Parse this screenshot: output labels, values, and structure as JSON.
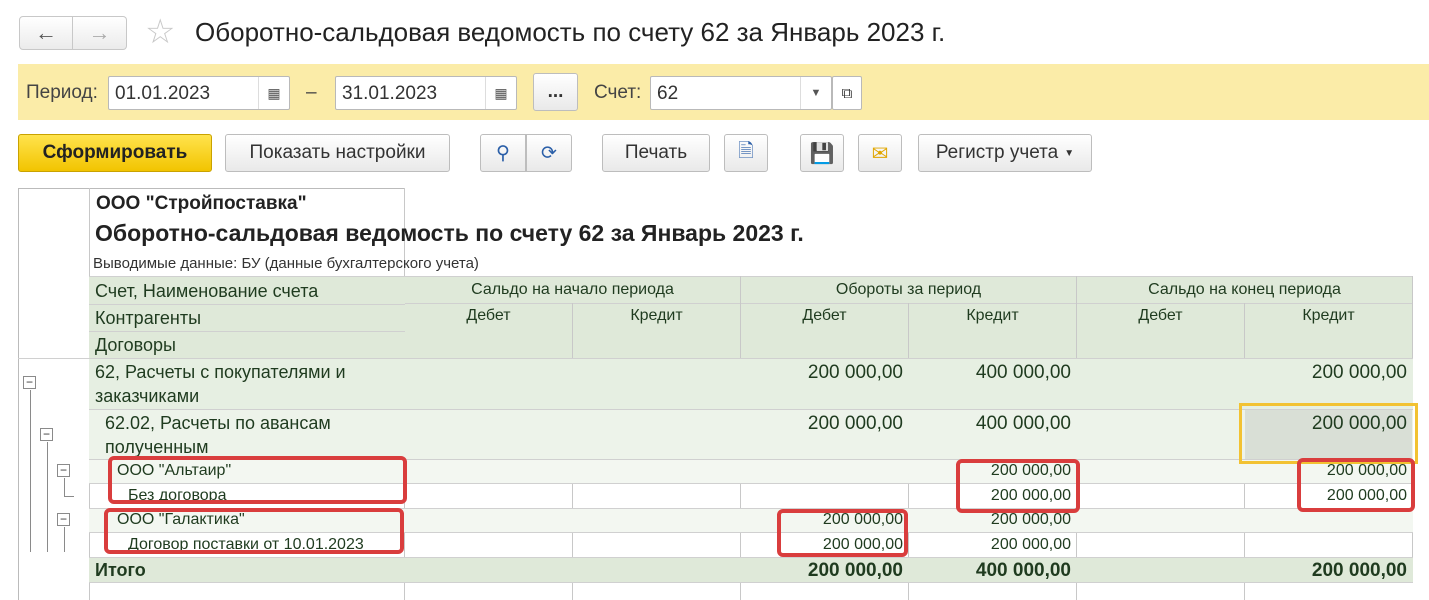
{
  "window": {
    "title": "Оборотно-сальдовая ведомость по счету 62 за Январь 2023 г."
  },
  "params": {
    "period_label": "Период:",
    "date_from": "01.01.2023",
    "dash": "–",
    "date_to": "31.01.2023",
    "more_label": "...",
    "account_label": "Счет:",
    "account_value": "62"
  },
  "toolbar": {
    "generate_label": "Сформировать",
    "settings_label": "Показать настройки",
    "print_label": "Печать",
    "register_label": "Регистр учета"
  },
  "report": {
    "organization": "ООО \"Стройпоставка\"",
    "title": "Оборотно-сальдовая ведомость по счету 62 за Январь 2023 г.",
    "subtitle": "Выводимые данные: БУ (данные бухгалтерского учета)",
    "headers": {
      "col_account": "Счет, Наименование счета",
      "col_counterparty": "Контрагенты",
      "col_contracts": "Договоры",
      "group_start": "Сальдо на начало периода",
      "group_turnover": "Обороты за период",
      "group_end": "Сальдо на конец периода",
      "debit": "Дебет",
      "credit": "Кредит"
    },
    "rows": [
      {
        "name": "62, Расчеты с покупателями и",
        "name2": "заказчиками",
        "turn_debit": "200 000,00",
        "turn_credit": "400 000,00",
        "end_credit": "200 000,00"
      },
      {
        "name": "62.02, Расчеты по авансам",
        "name2": "полученным",
        "turn_debit": "200 000,00",
        "turn_credit": "400 000,00",
        "end_credit": "200 000,00"
      },
      {
        "name": "ООО \"Альтаир\"",
        "turn_credit": "200 000,00",
        "end_credit": "200 000,00"
      },
      {
        "name": "Без договора",
        "turn_credit": "200 000,00",
        "end_credit": "200 000,00"
      },
      {
        "name": "ООО \"Галактика\"",
        "turn_debit": "200 000,00",
        "turn_credit": "200 000,00"
      },
      {
        "name": "Договор поставки от 10.01.2023",
        "turn_debit": "200 000,00",
        "turn_credit": "200 000,00"
      }
    ],
    "total": {
      "name": "Итого",
      "turn_debit": "200 000,00",
      "turn_credit": "400 000,00",
      "end_credit": "200 000,00"
    }
  },
  "colors": {
    "params_bg": "#fbeca8",
    "primary_button": "#f2c400",
    "header_green": "#dfe9d9",
    "highlight_red": "#d93d3d",
    "highlight_yellow": "#f2c232"
  }
}
